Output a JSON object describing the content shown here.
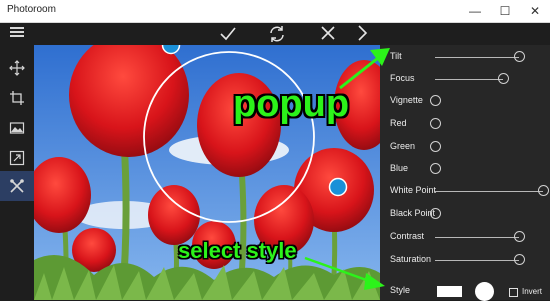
{
  "window": {
    "title": "Photoroom",
    "controls": {
      "minimize": "—",
      "maximize": "☐",
      "close": "✕"
    }
  },
  "toolbar": {
    "icons": [
      "hamburger-menu-icon",
      "checkmark-icon",
      "refresh-icon",
      "close-icon",
      "chevron-right-icon"
    ]
  },
  "tools": [
    {
      "icon": "move-arrows-icon",
      "active": false
    },
    {
      "icon": "crop-icon",
      "active": false
    },
    {
      "icon": "image-adjust-icon",
      "active": false
    },
    {
      "icon": "resize-icon",
      "active": false
    },
    {
      "icon": "tools-icon",
      "active": true
    }
  ],
  "panel": {
    "sliders": [
      {
        "label": "Tilt",
        "value": 0.78
      },
      {
        "label": "Focus",
        "value": 0.63
      },
      {
        "label": "Vignette",
        "value": 0.0
      },
      {
        "label": "Red",
        "value": 0.0
      },
      {
        "label": "Green",
        "value": 0.0
      },
      {
        "label": "Blue",
        "value": 0.0
      },
      {
        "label": "White Point",
        "value": 1.0
      },
      {
        "label": "Black Point",
        "value": 0.0
      },
      {
        "label": "Contrast",
        "value": 0.78
      },
      {
        "label": "Saturation",
        "value": 0.78
      }
    ],
    "style_label": "Style",
    "invert_label": "Invert",
    "invert_checked": false
  },
  "annotations": {
    "popup": "popup",
    "select_style": "select style",
    "color": "#2cf31a"
  },
  "colors": {
    "accent": "#2c3e63",
    "handle": "#1a90d8",
    "sky": "#3e7fd6",
    "tulip": "#d8141a",
    "leaf": "#6aa03a"
  }
}
